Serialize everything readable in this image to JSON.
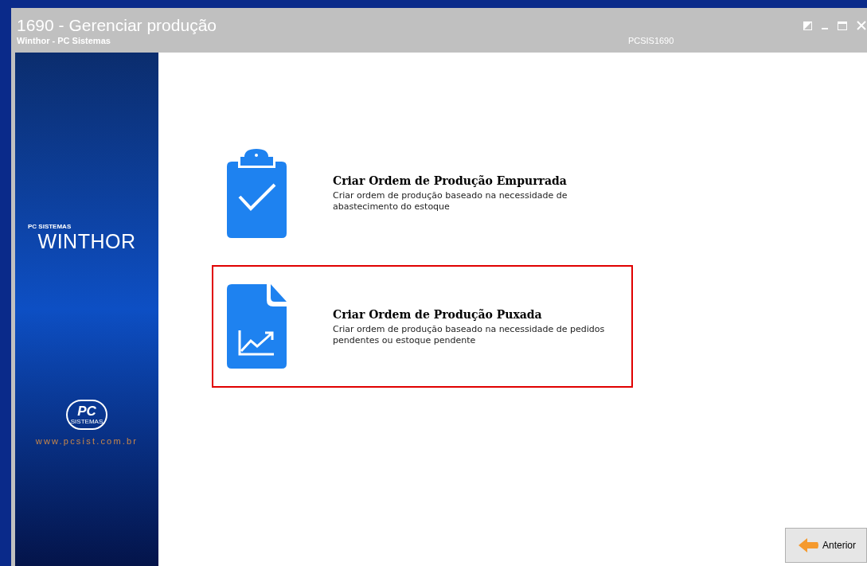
{
  "window": {
    "title": "1690 - Gerenciar produção",
    "subtitle": "Winthor - PC Sistemas",
    "code": "PCSIS1690"
  },
  "sidebar": {
    "brand_small": "PC SISTEMAS",
    "brand": "WINTHOR",
    "logo": "PC",
    "logo_small": "SISTEMAS",
    "url": "www.pcsist.com.br"
  },
  "options": [
    {
      "kind": "clipboard",
      "title": "Criar Ordem de Produção Empurrada",
      "description": "Criar ordem de produção baseado na necessidade de abastecimento do estoque",
      "selected": false
    },
    {
      "kind": "chart-document",
      "title": "Criar Ordem de Produção Puxada",
      "description": "Criar ordem de produção baseado na necessidade de pedidos pendentes ou estoque pendente",
      "selected": true
    }
  ],
  "buttons": [
    {
      "label": "Anterior"
    }
  ]
}
